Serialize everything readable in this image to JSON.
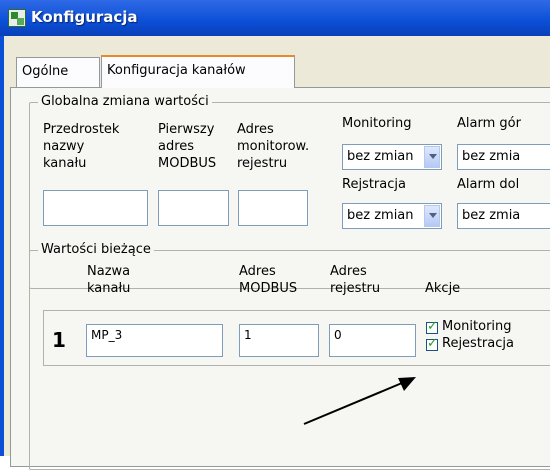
{
  "window": {
    "title": "Konfiguracja"
  },
  "tabs": [
    {
      "label": "Ogólne"
    },
    {
      "label": "Konfiguracja kanałów"
    }
  ],
  "global_change": {
    "legend": "Globalna zmiana wartości",
    "prefix_label_1": "Przedrostek",
    "prefix_label_2": "nazwy",
    "prefix_label_3": "kanału",
    "first_addr_label_1": "Pierwszy",
    "first_addr_label_2": "adres",
    "first_addr_label_3": "MODBUS",
    "mon_addr_label_1": "Adres",
    "mon_addr_label_2": "monitorow.",
    "mon_addr_label_3": "rejestru",
    "prefix_value": "",
    "first_addr_value": "",
    "mon_addr_value": "",
    "monitoring_label": "Monitoring",
    "monitoring_value": "bez zmian",
    "alarm_high_label": "Alarm gór",
    "alarm_high_value": "bez zmia",
    "registration_label": "Rejstracja",
    "registration_value": "bez zmian",
    "alarm_low_label": "Alarm dol",
    "alarm_low_value": "bez zmia"
  },
  "current_values": {
    "legend": "Wartości bieżące",
    "col_name_1": "Nazwa",
    "col_name_2": "kanału",
    "col_modbus_1": "Adres",
    "col_modbus_2": "MODBUS",
    "col_reg_1": "Adres",
    "col_reg_2": "rejestru",
    "col_actions": "Akcje",
    "rows": [
      {
        "num": "1",
        "name": "MP_3",
        "modbus": "1",
        "register": "0",
        "monitoring": "Monitoring",
        "monitoring_checked": true,
        "registration": "Rejestracja",
        "registration_checked": true
      }
    ]
  }
}
